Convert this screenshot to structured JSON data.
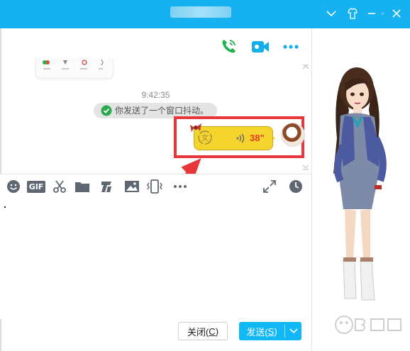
{
  "window": {
    "title": "",
    "controls": [
      "chevron-down-icon",
      "skin-icon",
      "minimize-icon",
      "maximize-icon",
      "close-icon"
    ]
  },
  "header_actions": {
    "items": [
      "phone-call-icon",
      "video-call-icon",
      "more-dots-icon"
    ]
  },
  "chat": {
    "timestamp": "9:42:35",
    "system_notice": "你发送了一个窗口抖动。",
    "voice_message": {
      "duration": "38\""
    }
  },
  "toolbar": {
    "items": [
      "emoji-icon",
      "gif-icon",
      "scissors-icon",
      "folder-icon",
      "font-icon",
      "image-icon",
      "shake-icon",
      "more-dots-icon",
      "expand-icon",
      "history-clock-icon"
    ],
    "gif_label": "GIF"
  },
  "footer": {
    "close_label": "关闭(",
    "close_key": "C",
    "close_end": ")",
    "send_label": "发送(",
    "send_key": "S",
    "send_end": ")"
  },
  "colors": {
    "titlebar": "#15b1f0",
    "send_button": "#12b7f5",
    "highlight": "#e8363b",
    "voice_bubble": "#f6d42e"
  }
}
